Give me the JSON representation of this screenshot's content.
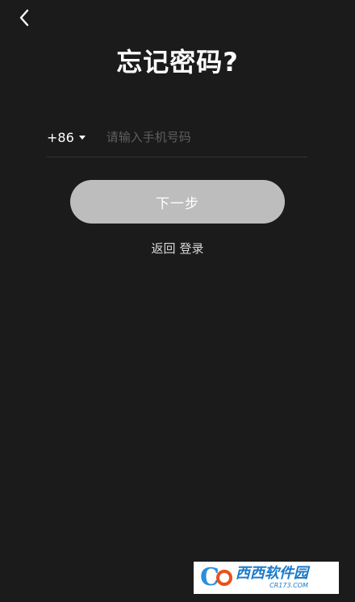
{
  "header": {
    "back_icon": "chevron-left-icon",
    "title": "忘记密码?"
  },
  "form": {
    "country_code": "+86",
    "country_caret_icon": "caret-down-icon",
    "phone_placeholder": "请输入手机号码",
    "phone_value": ""
  },
  "actions": {
    "next_label": "下一步",
    "back_label": "返回",
    "login_label": "登录"
  },
  "watermark": {
    "logo_glyph": "C",
    "brand_text": "西西软件园",
    "brand_url": "CR173.COM"
  },
  "colors": {
    "background": "#1b1b1b",
    "button_fill": "#bdbdbd",
    "placeholder": "#5e5e5e",
    "divider": "#333333"
  }
}
